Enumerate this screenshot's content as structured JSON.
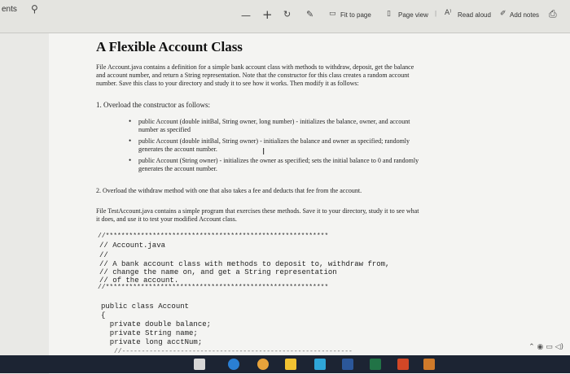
{
  "toolbar": {
    "tab_fragment": "ents",
    "zoom_out": "—",
    "zoom_in": "+",
    "fit_to_page": "Fit to page",
    "page_view": "Page view",
    "read_aloud": "Read aloud",
    "add_notes": "Add notes"
  },
  "doc": {
    "title": "A Flexible Account Class",
    "intro_1": "File Account.java contains a definition for a simple bank account class with methods to withdraw, deposit, get the balance",
    "intro_2": "and account number, and return a String representation. Note that the constructor for this class creates a random account",
    "intro_3": "number. Save this class to your directory and study it to see how it works. Then modify it as follows:",
    "item1": "1.   Overload the constructor as follows:",
    "b1_1": "public Account (double initBal, String owner, long number) - initializes the balance, owner, and account",
    "b1_2": "number as specified",
    "b2_1": "public Account (double initBal, String owner) - initializes the balance and owner as specified; randomly",
    "b2_2": "generates the account number.",
    "b3_1": "public Account (String owner) - initializes the owner as specified; sets the initial balance to 0 and randomly",
    "b3_2": "generates the account number.",
    "item2": "2.   Overload the withdraw method with one that also takes a fee and deducts that fee from the account.",
    "test_1": "File TestAccount.java contains a simple program that exercises these methods. Save it to your directory, study it to see what",
    "test_2": "it does, and use it to test your modified Account class."
  },
  "code": {
    "stars_top": "//*********************************************************",
    "line1": "// Account.java",
    "line2": "//",
    "line3": "// A bank account class with methods to deposit to, withdraw from,",
    "line4": "// change the name on, and get a String representation",
    "line5": "// of the account.",
    "stars_bottom": "//*********************************************************",
    "class_decl": "public class Account",
    "brace": "{",
    "field1": "  private double balance;",
    "field2": "  private String name;",
    "field3": "  private long acctNum;",
    "dashes": "//-----------------------------------------------------------"
  },
  "colors": {
    "taskbar": "#1c2433",
    "page": "#f4f4f2",
    "toolbar": "#e4e4e0"
  },
  "icons": [
    "search-icon",
    "read-aloud-icon",
    "draw-icon",
    "eraser-icon",
    "fit-page-icon",
    "page-view-icon",
    "add-notes-icon",
    "print-icon"
  ]
}
